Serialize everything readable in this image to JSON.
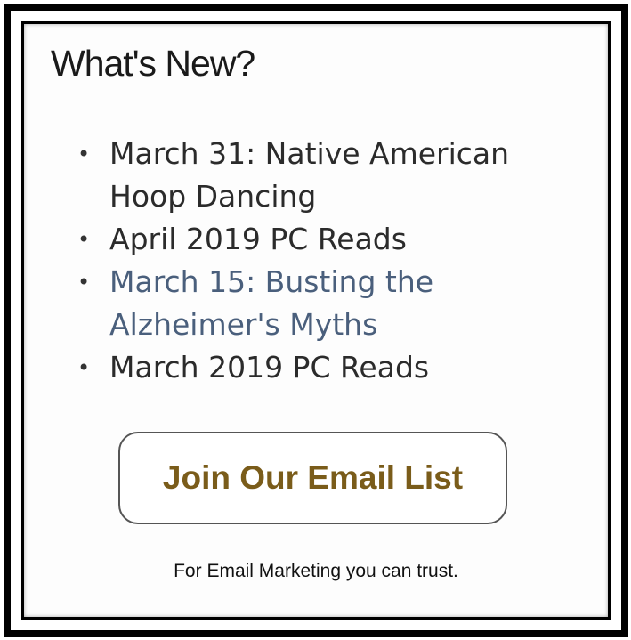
{
  "widget": {
    "title": "What's New?"
  },
  "news_items": [
    {
      "text": "March 31: Native American Hoop Dancing",
      "style": "link",
      "bullet": "•"
    },
    {
      "text": "April 2019 PC Reads",
      "style": "link",
      "bullet": "•"
    },
    {
      "text": "March 15: Busting the Alzheimer's Myths",
      "style": "visited-link",
      "bullet": "•"
    },
    {
      "text": "March 2019 PC Reads",
      "style": "link",
      "bullet": "•"
    }
  ],
  "email_signup": {
    "button_label": "Join Our Email List",
    "tagline": "For Email Marketing you can trust."
  },
  "colors": {
    "frame": "#000000",
    "link_text": "#2b2b2b",
    "visited_link_text": "#4a5f7c",
    "button_text": "#7a5c1a"
  }
}
